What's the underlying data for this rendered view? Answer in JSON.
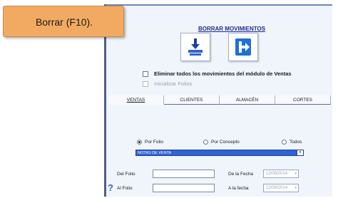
{
  "tooltip": {
    "text": "Borrar (F10)."
  },
  "dialog": {
    "title": "BORRAR MOVIMIENTOS"
  },
  "buttons": {
    "delete_icon": "delete-stack-icon",
    "exit_icon": "exit-arrow-icon"
  },
  "options": {
    "delete_all": "Eliminar todos los movimientos del módulo de Ventas",
    "init_folios": "Inicializar Folios"
  },
  "tabs": [
    {
      "label": "VENTAS",
      "active": true
    },
    {
      "label": "CLIENTES",
      "active": false
    },
    {
      "label": "ALMACÉN",
      "active": false
    },
    {
      "label": "CORTES",
      "active": false
    }
  ],
  "filter": {
    "by_folio": "Por Folio",
    "by_concept": "Por Concepto",
    "all": "Todos",
    "selected": "NOTAS DE VENTA"
  },
  "range": {
    "del_folio": "Del Folio",
    "al_folio": "Al Folio",
    "de_la_fecha": "De la Fecha",
    "a_la_fecha": "A la fecha",
    "date_from": "12/09/2014",
    "date_to": "12/09/2014"
  },
  "help": {
    "label": "?"
  },
  "colors": {
    "accent": "#2f63d6",
    "title": "#1c2f8f",
    "tooltip_bg": "#f2aa62"
  }
}
